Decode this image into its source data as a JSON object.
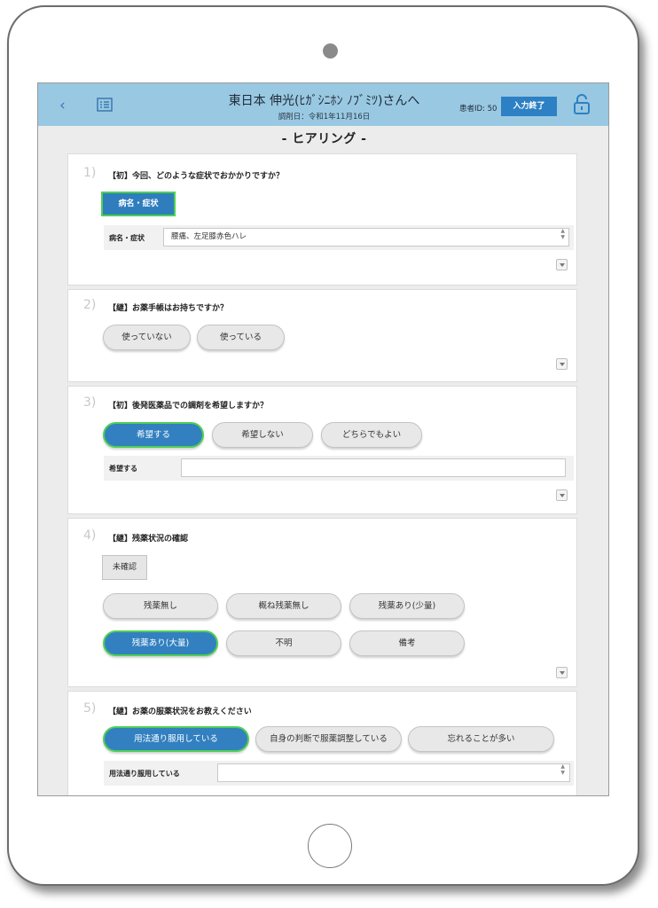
{
  "header": {
    "title": "東日本 伸光(ﾋｶﾞｼﾆﾎﾝ ﾉﾌﾞﾐﾂ)さんへ",
    "dispense_date": "調剤日：令和1年11月16日",
    "patient_id": "患者ID: 50",
    "finish_button": "入力終了"
  },
  "page_title": "- ヒアリング -",
  "questions": [
    {
      "number": "1)",
      "text": "【初】今回、どのような症状でおかかりですか？",
      "options": [
        "病名・症状"
      ],
      "selected": "病名・症状",
      "field_label": "病名・症状",
      "field_value": "腰痛、左足膝赤色ハレ"
    },
    {
      "number": "2)",
      "text": "【継】お薬手帳はお持ちですか？",
      "options": [
        "使っていない",
        "使っている"
      ]
    },
    {
      "number": "3)",
      "text": "【初】後発医薬品での調剤を希望しますか？",
      "options": [
        "希望する",
        "希望しない",
        "どちらでもよい"
      ],
      "selected": "希望する",
      "field_label": "希望する",
      "field_value": ""
    },
    {
      "number": "4)",
      "text": "【継】残薬状況の確認",
      "status_button": "未確認",
      "options": [
        "残薬無し",
        "概ね残薬無し",
        "残薬あり(少量)",
        "残薬あり(大量)",
        "不明",
        "備考"
      ],
      "selected": "残薬あり(大量)"
    },
    {
      "number": "5)",
      "text": "【継】お薬の服薬状況をお教えください",
      "options": [
        "用法通り服用している",
        "自身の判断で服薬調整している",
        "忘れることが多い"
      ],
      "selected": "用法通り服用している",
      "field_label": "用法通り服用している",
      "field_value": ""
    }
  ],
  "colors": {
    "header_bg": "#99c8e2",
    "accent": "#3280c0",
    "selected_border": "#4fcf54"
  }
}
